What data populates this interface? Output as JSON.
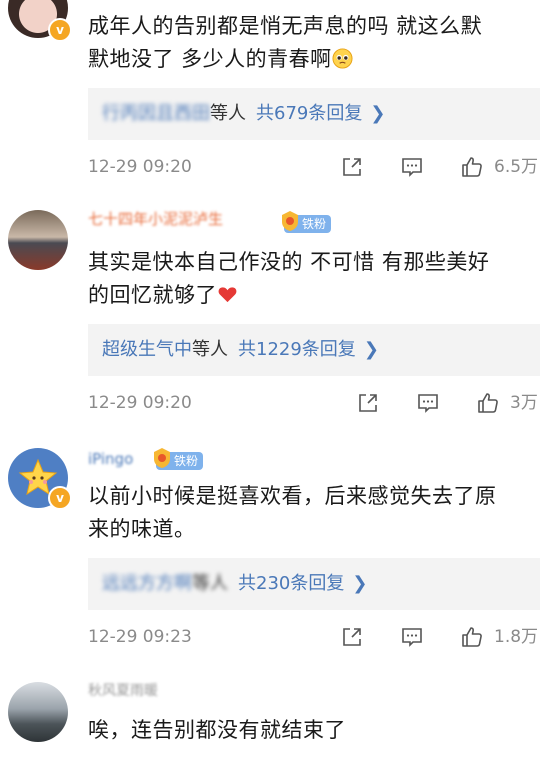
{
  "comments": [
    {
      "username": "",
      "badge": "",
      "text_lines": [
        "成年人的告别都是悄无声息的吗 就这么默",
        "默地没了 多少人的青春啊"
      ],
      "emoji": "pleading-face",
      "reply_names": "行丙因且西田",
      "reply_deng": "等人",
      "reply_count": "共679条回复",
      "time": "12-29 09:20",
      "likes": "6.5万"
    },
    {
      "username": "七十四年小泥泥泸生",
      "badge": "铁粉",
      "text_lines": [
        "其实是快本自己作没的 不可惜 有那些美好",
        "的回忆就够了"
      ],
      "emoji": "red-heart",
      "reply_names": "超级生气中",
      "reply_deng": "等人",
      "reply_count": "共1229条回复",
      "time": "12-29 09:20",
      "likes": "3万"
    },
    {
      "username": "iPingo",
      "badge": "铁粉",
      "text_lines": [
        "以前小时候是挺喜欢看，后来感觉失去了原",
        "来的味道。"
      ],
      "reply_names": "远远方方啊",
      "reply_deng": "等人",
      "reply_count": "共230条回复",
      "time": "12-29 09:23",
      "likes": "1.8万"
    },
    {
      "username": "秋风夏雨暖",
      "text_lines": [
        "唉，连告别都没有就结束了"
      ]
    }
  ],
  "colors": {
    "link_blue": "#4a78b8",
    "username_orange": "#e86b3a",
    "fan_badge": "#7fb2ec",
    "meta_gray": "#8a8a8a",
    "reply_bg": "#f3f3f3"
  },
  "icons": [
    "share-icon",
    "comment-icon",
    "like-icon",
    "chevron-right-icon",
    "verified-badge-icon"
  ]
}
